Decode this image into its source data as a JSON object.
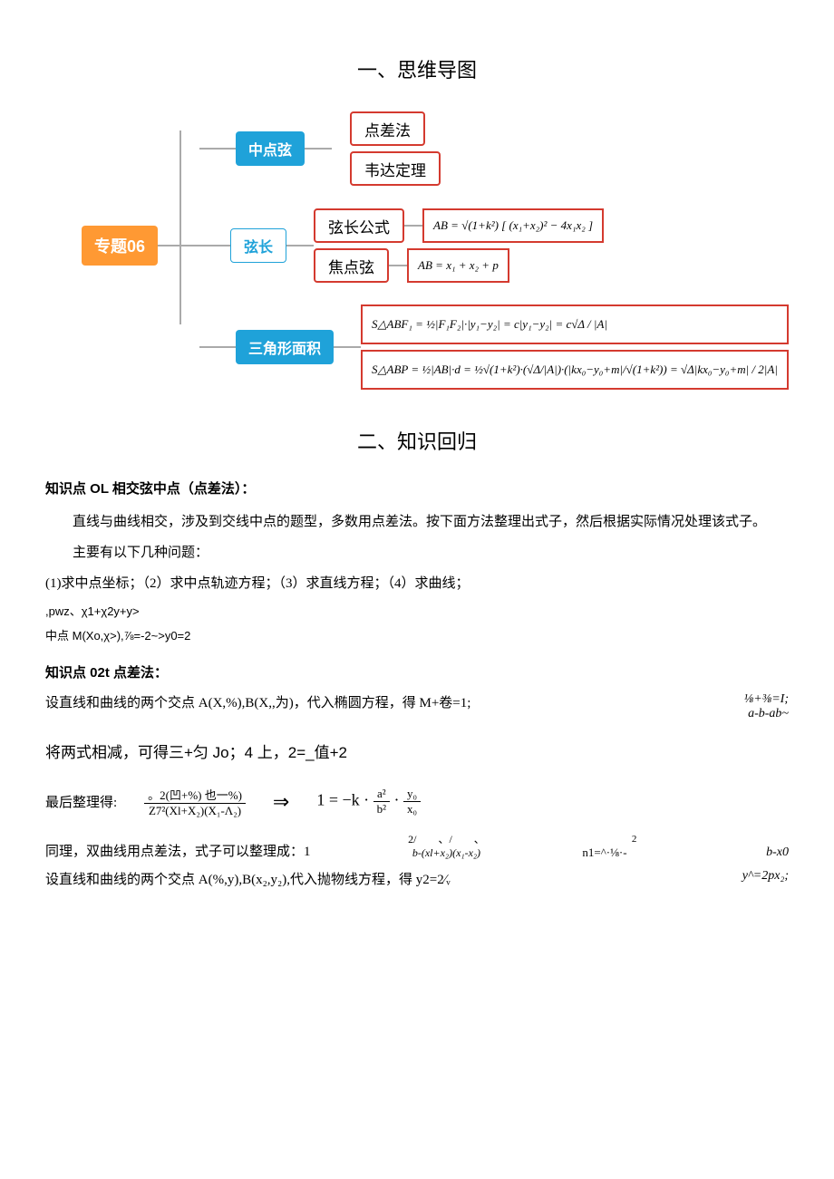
{
  "section1_title": "一、思维导图",
  "diagram": {
    "root": "专题06",
    "branch1": {
      "label": "中点弦",
      "leaf1": "点差法",
      "leaf2": "韦达定理"
    },
    "branch2": {
      "label": "弦长",
      "leaf1": "弦长公式",
      "leaf1_formula": "AB = √(1+k²) [ (x₁+x₂)² − 4x₁x₂ ]",
      "leaf2": "焦点弦",
      "leaf2_formula": "AB = x₁ + x₂ + p"
    },
    "branch3": {
      "label": "三角形面积",
      "formula1": "S△ABF₁ = ½|F₁F₂|·|y₁−y₂| = c|y₁−y₂| = c√Δ / |A|",
      "formula2": "S△ABP = ½|AB|·d = ½√(1+k²)·(√Δ/|A|)·(|kx₀−y₀+m|/√(1+k²)) = √Δ|kx₀−y₀+m| / 2|A|"
    }
  },
  "section2_title": "二、知识回归",
  "kp01_title": "知识点 OL 相交弦中点（点差法）：",
  "kp01_p1": "直线与曲线相交，涉及到交线中点的题型，多数用点差法。按下面方法整理出式子，然后根据实际情况处理该式子。",
  "kp01_p2": "主要有以下几种问题：",
  "kp01_list": "(1)求中点坐标；（2）求中点轨迹方程；（3）求直线方程；（4）求曲线；",
  "kp01_cramped1": ",pwz、χ1+χ2y+y>",
  "kp01_cramped2": "中点 M(Xo,χ>),⅞=-2~>y0=2",
  "kp02_title": "知识点 02t 点差法：",
  "kp02_line1_left": "设直线和曲线的两个交点 A(X,%),B(X,,为)，代入椭圆方程，得 M+卷=1;",
  "kp02_line1_right1": "⅛+⅜=I;",
  "kp02_line1_right2": "a-b-ab~",
  "kp02_line2": "将两式相减，可得三+匀 Jo；4 上，2=_值+2",
  "kp02_final_label": "最后整理得:",
  "kp02_final_num": "。2(凹+%) 也一%)",
  "kp02_final_den": "Z7²(Xl+X₂)(X₁-Λ₂)",
  "kp02_rhs_prefix": "1 = −k ·",
  "kp02_rhs_f1n": "a²",
  "kp02_rhs_f1d": "b²",
  "kp02_rhs_f2n": "y₀",
  "kp02_rhs_f2d": "x₀",
  "kp02_same_left": "同理，双曲线用点差法，式子可以整理成：1",
  "kp02_same_mid_top": "2/　　、/　　、",
  "kp02_same_mid_bot": "b-(xl+x₂)(x₁-x₂)",
  "kp02_same_r1": "n1=^·⅛·-",
  "kp02_same_r1_sup": "2",
  "kp02_same_r2": "b-x0",
  "kp02_parab_left": "设直线和曲线的两个交点 A(%,y),B(x₂,y₂),代入抛物线方程，得 y2=2∕ᵥ",
  "kp02_parab_right": "y^=2px₂;"
}
